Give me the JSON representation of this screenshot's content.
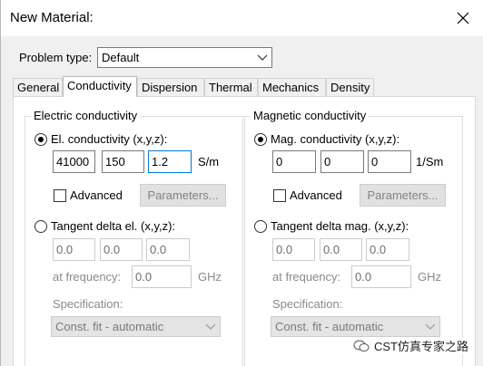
{
  "window": {
    "title": "New Material:"
  },
  "problem_type": {
    "label": "Problem type:",
    "value": "Default"
  },
  "tabs": [
    {
      "label": "General"
    },
    {
      "label": "Conductivity",
      "active": true
    },
    {
      "label": "Dispersion"
    },
    {
      "label": "Thermal"
    },
    {
      "label": "Mechanics"
    },
    {
      "label": "Density"
    }
  ],
  "electric": {
    "group_title": "Electric conductivity",
    "option1": {
      "label": "El. conductivity (x,y,z):",
      "selected": true
    },
    "values": [
      "41000",
      "150",
      "1.2"
    ],
    "unit": "S/m",
    "advanced": {
      "label": "Advanced",
      "checked": false
    },
    "parameters_button": "Parameters...",
    "option2": {
      "label": "Tangent delta el. (x,y,z):",
      "selected": false
    },
    "tan_values": [
      "0.0",
      "0.0",
      "0.0"
    ],
    "freq_label": "at frequency:",
    "freq_value": "0.0",
    "freq_unit": "GHz",
    "spec_label": "Specification:",
    "spec_value": "Const. fit - automatic"
  },
  "magnetic": {
    "group_title": "Magnetic conductivity",
    "option1": {
      "label": "Mag. conductivity (x,y,z):",
      "selected": true
    },
    "values": [
      "0",
      "0",
      "0"
    ],
    "unit": "1/Sm",
    "advanced": {
      "label": "Advanced",
      "checked": false
    },
    "parameters_button": "Parameters...",
    "option2": {
      "label": "Tangent delta mag. (x,y,z):",
      "selected": false
    },
    "tan_values": [
      "0.0",
      "0.0",
      "0.0"
    ],
    "freq_label": "at frequency:",
    "freq_value": "0.0",
    "freq_unit": "GHz",
    "spec_label": "Specification:",
    "spec_value": "Const. fit - automatic"
  },
  "watermark": {
    "text": "CST仿真专家之路"
  },
  "colors": {
    "focus_border": "#0078d7",
    "dialog_bg": "#f0f0f0",
    "disabled_text": "#8a8a8a"
  }
}
